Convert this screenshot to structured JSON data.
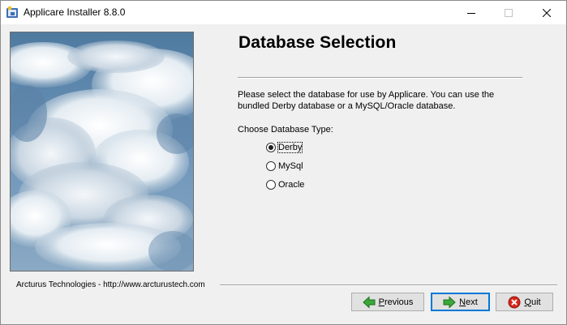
{
  "window": {
    "title": "Applicare Installer 8.8.0",
    "icon": "installer-app-icon"
  },
  "page": {
    "heading": "Database Selection",
    "description": "Please select the database for use by Applicare. You can use the bundled Derby database or a MySQL/Oracle database.",
    "choose_label": "Choose Database Type:",
    "options": [
      {
        "label": "Derby",
        "selected": true
      },
      {
        "label": "MySql",
        "selected": false
      },
      {
        "label": "Oracle",
        "selected": false
      }
    ]
  },
  "footer": {
    "text": "Arcturus Technologies - http://www.arcturustech.com"
  },
  "buttons": {
    "previous_mnemonic": "P",
    "previous_rest": "revious",
    "next_mnemonic": "N",
    "next_rest": "ext",
    "quit_mnemonic": "Q",
    "quit_rest": "uit"
  },
  "colors": {
    "accent": "#0078d7",
    "arrow_green": "#3aa83a",
    "quit_red": "#d9261c",
    "sky_blue": "#5f86a8"
  }
}
